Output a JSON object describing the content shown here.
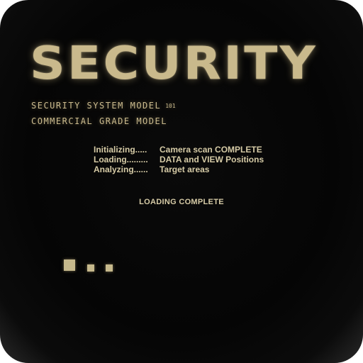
{
  "screen": {
    "title": "SECURITY",
    "subtitle_line1": "Security System Model",
    "subtitle_model_number": "101",
    "subtitle_line2": "Commercial Grade Model"
  },
  "status": {
    "rows": [
      {
        "key": "Initializing.....",
        "value": "Camera scan COMPLETE"
      },
      {
        "key": "Loading.........",
        "value": "DATA and VIEW Positions"
      },
      {
        "key": "Analyzing......",
        "value": "Target areas"
      }
    ],
    "complete_text": "LOADING COMPLETE"
  },
  "colors": {
    "text_gold": "#c9b98c",
    "background": "#050505",
    "bezel": "#ffffff"
  },
  "progress": {
    "indicator": "loading-dots",
    "dots_shown": 3
  }
}
